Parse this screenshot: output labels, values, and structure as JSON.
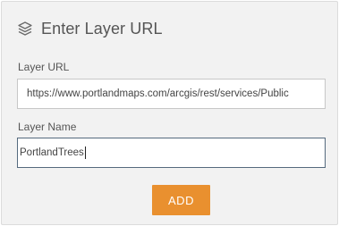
{
  "dialog": {
    "title": "Enter Layer URL",
    "icon": "layers-icon"
  },
  "layer_url": {
    "label": "Layer URL",
    "value": "https://www.portlandmaps.com/arcgis/rest/services/Public"
  },
  "layer_name": {
    "label": "Layer Name",
    "value": "PortlandTrees"
  },
  "add_button": {
    "label": "ADD"
  },
  "colors": {
    "accent": "#e9902f",
    "panel": "#f2f2f2",
    "focus_border": "#556a7e"
  }
}
